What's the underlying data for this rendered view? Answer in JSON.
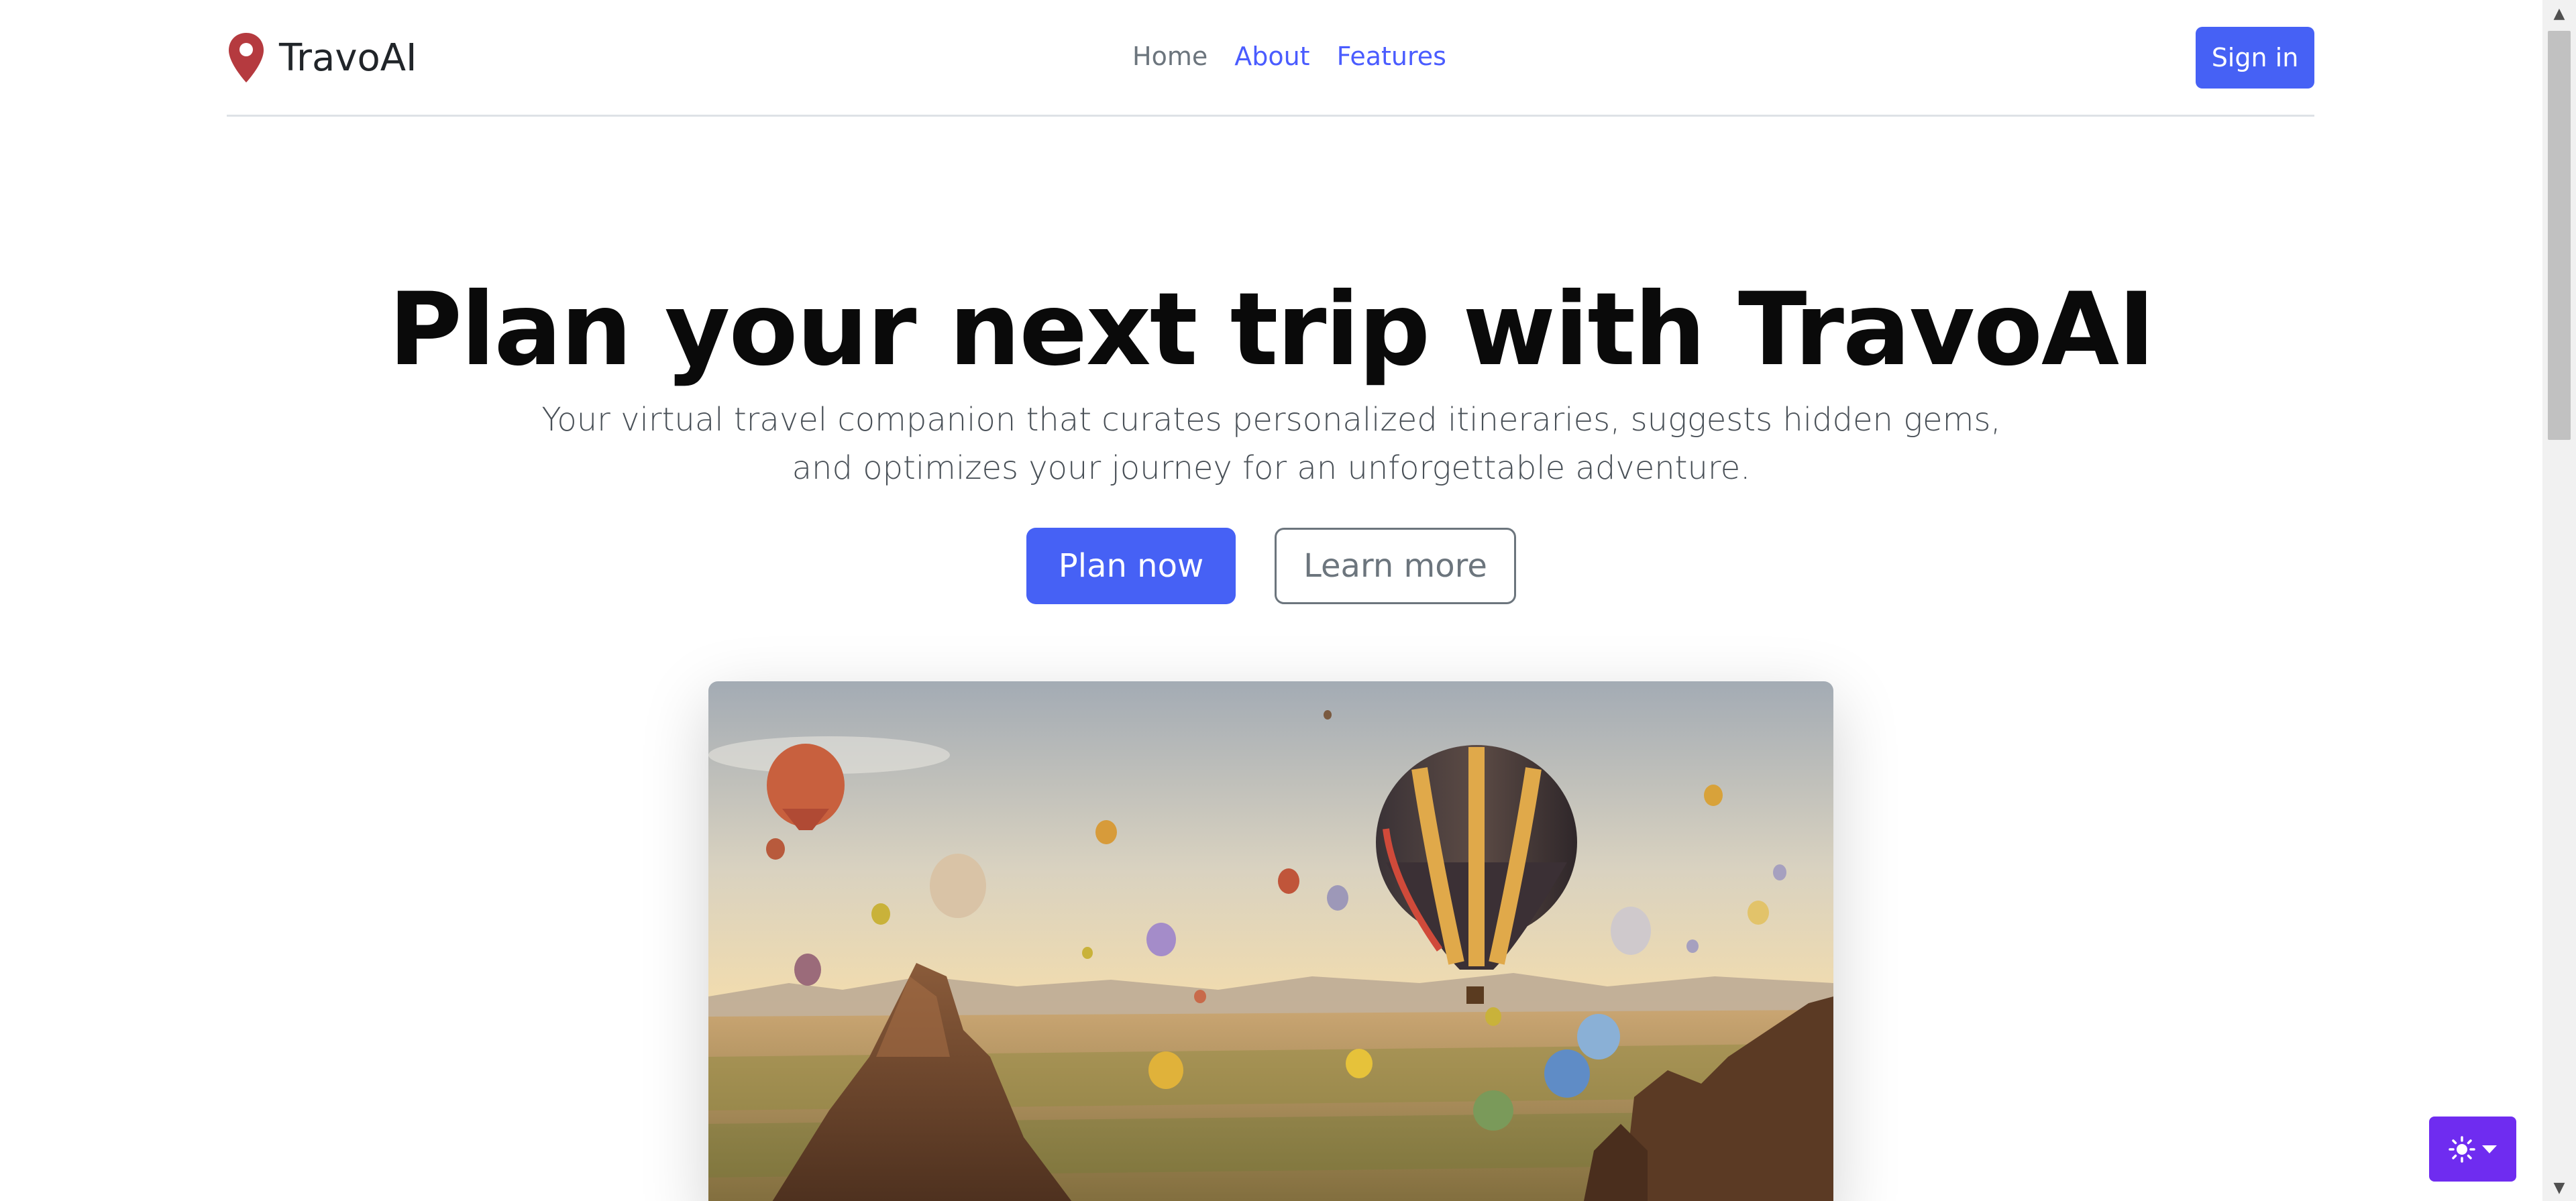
{
  "brand": {
    "name": "TravoAI",
    "icon": "map-pin-icon",
    "icon_color": "#b53a3f"
  },
  "nav": {
    "items": [
      {
        "label": "Home",
        "active": true
      },
      {
        "label": "About",
        "active": false
      },
      {
        "label": "Features",
        "active": false
      }
    ]
  },
  "header": {
    "signin_label": "Sign in"
  },
  "hero": {
    "title": "Plan your next trip with TravoAI",
    "lead_line1": "Your virtual travel companion that curates personalized itineraries, suggests hidden gems,",
    "lead_line2": "and optimizes your journey for an unforgettable adventure.",
    "primary_label": "Plan now",
    "secondary_label": "Learn more",
    "image_subject": "hot-air-balloons-over-rock-valley"
  },
  "theme_toggle": {
    "icon": "sun-icon",
    "caret_icon": "caret-down-icon"
  },
  "colors": {
    "accent": "#4661f5",
    "toggle": "#6f2cf0",
    "link": "#4a5cff",
    "muted": "#6c757d"
  }
}
